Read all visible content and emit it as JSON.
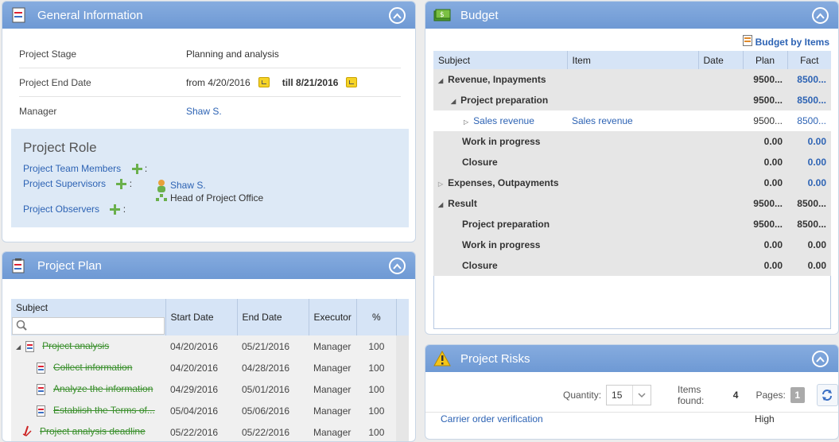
{
  "general": {
    "title": "General Information",
    "stage_label": "Project Stage",
    "stage_value": "Planning and analysis",
    "end_label": "Project End Date",
    "end_from": "from 4/20/2016",
    "end_till": "till 8/21/2016",
    "manager_label": "Manager",
    "manager_value": "Shaw S.",
    "role": {
      "title": "Project Role",
      "team": "Project Team Members",
      "supervisors": "Project Supervisors",
      "observers": "Project Observers",
      "colon": ":",
      "supervisor_name": "Shaw S.",
      "supervisor_position": "Head of Project Office"
    }
  },
  "budget": {
    "title": "Budget",
    "by_items": "Budget by Items",
    "columns": [
      "Subject",
      "Item",
      "Date",
      "Plan",
      "Fact"
    ],
    "rows": [
      {
        "subject": "Revenue, Inpayments",
        "item": "",
        "plan": "9500...",
        "fact": "8500..."
      },
      {
        "subject": "Project preparation",
        "item": "",
        "plan": "9500...",
        "fact": "8500..."
      },
      {
        "subject": "Sales revenue",
        "item": "Sales revenue",
        "plan": "9500...",
        "fact": "8500..."
      },
      {
        "subject": "Work in progress",
        "item": "",
        "plan": "0.00",
        "fact": "0.00"
      },
      {
        "subject": "Closure",
        "item": "",
        "plan": "0.00",
        "fact": "0.00"
      },
      {
        "subject": "Expenses, Outpayments",
        "item": "",
        "plan": "0.00",
        "fact": "0.00"
      },
      {
        "subject": "Result",
        "item": "",
        "plan": "9500...",
        "fact": "8500..."
      },
      {
        "subject": "Project preparation",
        "item": "",
        "plan": "9500...",
        "fact": "8500..."
      },
      {
        "subject": "Work in progress",
        "item": "",
        "plan": "0.00",
        "fact": "0.00"
      },
      {
        "subject": "Closure",
        "item": "",
        "plan": "0.00",
        "fact": "0.00"
      }
    ]
  },
  "plan": {
    "title": "Project Plan",
    "columns": [
      "Subject",
      "Start Date",
      "End Date",
      "Executor",
      "%"
    ],
    "rows": [
      {
        "subject": "Project analysis",
        "start": "04/20/2016",
        "end": "05/21/2016",
        "executor": "Manager",
        "pct": "100"
      },
      {
        "subject": "Collect information",
        "start": "04/20/2016",
        "end": "04/28/2016",
        "executor": "Manager",
        "pct": "100"
      },
      {
        "subject": "Analyze the information",
        "start": "04/29/2016",
        "end": "05/01/2016",
        "executor": "Manager",
        "pct": "100"
      },
      {
        "subject": "Establish the Terms of...",
        "start": "05/04/2016",
        "end": "05/06/2016",
        "executor": "Manager",
        "pct": "100"
      },
      {
        "subject": "Project analysis deadline",
        "start": "05/22/2016",
        "end": "05/22/2016",
        "executor": "Manager",
        "pct": "100"
      }
    ]
  },
  "risks": {
    "title": "Project Risks",
    "quantity_label": "Quantity:",
    "quantity_value": "15",
    "found_label": "Items found:",
    "found_value": "4",
    "pages_label": "Pages:",
    "pages_value": "1",
    "first_risk": "Carrier order verification",
    "first_level": "High"
  }
}
